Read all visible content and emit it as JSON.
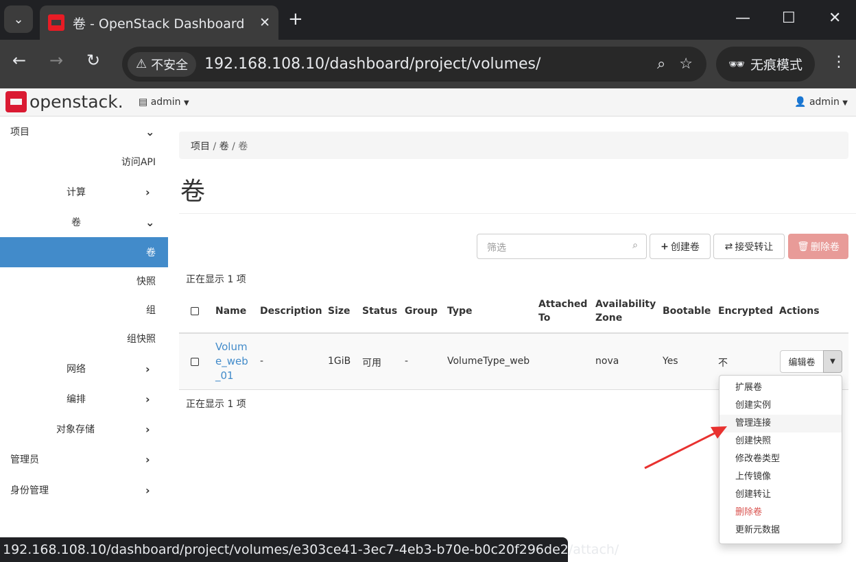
{
  "browser": {
    "tab_title": "卷 - OpenStack Dashboard",
    "insecure_label": "不安全",
    "url": "192.168.108.10/dashboard/project/volumes/",
    "incognito_label": "无痕模式",
    "status_url": "192.168.108.10/dashboard/project/volumes/e303ce41-3ec7-4eb3-b70e-b0c20f296de2/attach/"
  },
  "header": {
    "logo_text": "openstack.",
    "project": "admin",
    "user": "admin"
  },
  "sidebar": {
    "items": [
      {
        "label": "项目",
        "chevron": "down"
      },
      {
        "label": "访问API"
      },
      {
        "label": "计算",
        "chevron": "right"
      },
      {
        "label": "卷",
        "chevron": "down"
      },
      {
        "label": "卷",
        "active": true
      },
      {
        "label": "快照"
      },
      {
        "label": "组"
      },
      {
        "label": "组快照"
      },
      {
        "label": "网络",
        "chevron": "right"
      },
      {
        "label": "编排",
        "chevron": "right"
      },
      {
        "label": "对象存储",
        "chevron": "right"
      },
      {
        "label": "管理员",
        "chevron": "right"
      },
      {
        "label": "身份管理",
        "chevron": "right"
      }
    ]
  },
  "breadcrumb": [
    "项目",
    "卷",
    "卷"
  ],
  "page_title": "卷",
  "toolbar": {
    "filter_placeholder": "筛选",
    "create_label": "创建卷",
    "accept_transfer_label": "接受转让",
    "delete_label": "删除卷"
  },
  "count_text": "正在显示 1 项",
  "table": {
    "headers": [
      "Name",
      "Description",
      "Size",
      "Status",
      "Group",
      "Type",
      "Attached To",
      "Availability Zone",
      "Bootable",
      "Encrypted",
      "Actions"
    ],
    "rows": [
      {
        "name": "Volume_web_01",
        "description": "-",
        "size": "1GiB",
        "status": "可用",
        "group": "-",
        "type": "VolumeType_web",
        "attached_to": "",
        "zone": "nova",
        "bootable": "Yes",
        "encrypted": "不",
        "action": "编辑卷"
      }
    ]
  },
  "dropdown": {
    "items": [
      {
        "label": "扩展卷"
      },
      {
        "label": "创建实例"
      },
      {
        "label": "管理连接",
        "hover": true
      },
      {
        "label": "创建快照"
      },
      {
        "label": "修改卷类型"
      },
      {
        "label": "上传镜像"
      },
      {
        "label": "创建转让"
      },
      {
        "label": "删除卷",
        "danger": true
      },
      {
        "label": "更新元数据"
      }
    ]
  },
  "colors": {
    "accent": "#428bca",
    "brand": "#da1a32",
    "danger": "#d9534f",
    "arrow": "#e8312f"
  }
}
